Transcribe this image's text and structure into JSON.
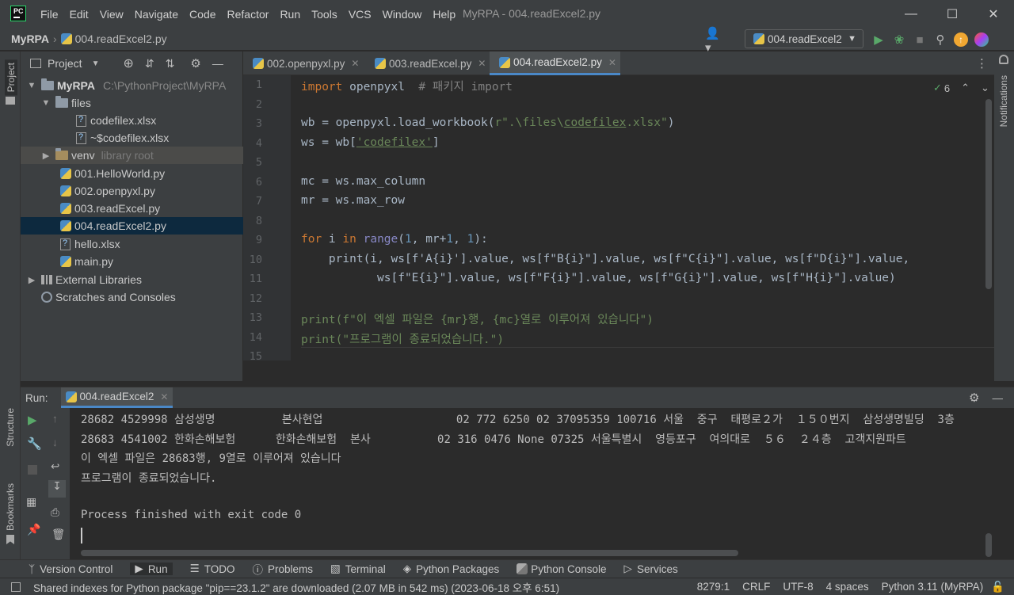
{
  "window": {
    "title": "MyRPA - 004.readExcel2.py",
    "menu": [
      "File",
      "Edit",
      "View",
      "Navigate",
      "Code",
      "Refactor",
      "Run",
      "Tools",
      "VCS",
      "Window",
      "Help"
    ]
  },
  "navbar": {
    "project": "MyRPA",
    "file": "004.readExcel2.py",
    "run_config": "004.readExcel2"
  },
  "project_panel": {
    "title": "Project",
    "root_name": "MyRPA",
    "root_path": "C:\\PythonProject\\MyRPA",
    "files_folder": "files",
    "file1": "codefilex.xlsx",
    "file2": "~$codefilex.xlsx",
    "venv": "venv",
    "venv_hint": "library root",
    "py1": "001.HelloWorld.py",
    "py2": "002.openpyxl.py",
    "py3": "003.readExcel.py",
    "py4": "004.readExcel2.py",
    "xlsx": "hello.xlsx",
    "main": "main.py",
    "ext_libs": "External Libraries",
    "scratches": "Scratches and Consoles"
  },
  "tabs": [
    "002.openpyxl.py",
    "003.readExcel.py",
    "004.readExcel2.py"
  ],
  "editor": {
    "line_numbers": [
      "1",
      "2",
      "3",
      "4",
      "5",
      "6",
      "7",
      "8",
      "9",
      "10",
      "11",
      "12",
      "13",
      "14",
      "15"
    ],
    "inspection_count": "6"
  },
  "code_lines": {
    "l1_kw": "import",
    "l1_mod": " openpyxl  ",
    "l1_cm": "# 패키지 import",
    "l3_a": "wb = openpyxl.load_workbook(",
    "l3_s1": "r\".\\files\\",
    "l3_s2": "codefilex",
    "l3_s3": ".xlsx\"",
    "l3_b": ")",
    "l4_a": "ws = wb[",
    "l4_s": "'codefilex'",
    "l4_b": "]",
    "l6": "mc = ws.max_column",
    "l7": "mr = ws.max_row",
    "l9_kw1": "for",
    "l9_a": " i ",
    "l9_kw2": "in",
    "l9_b": " ",
    "l9_bi": "range",
    "l9_c": "(",
    "l9_n1": "1",
    "l9_d": ", mr+",
    "l9_n2": "1",
    "l9_e": ", ",
    "l9_n3": "1",
    "l9_f": "):",
    "l10": "    print(i, ws[f'A{i}'].value, ws[f\"B{i}\"].value, ws[f\"C{i}\"].value, ws[f\"D{i}\"].value,",
    "l11": "           ws[f\"E{i}\"].value, ws[f\"F{i}\"].value, ws[f\"G{i}\"].value, ws[f\"H{i}\"].value)",
    "l13": "print(f\"이 엑셀 파일은 {mr}행, {mc}열로 이루어져 있습니다\")",
    "l14": "print(\"프로그램이 종료되었습니다.\")"
  },
  "run_panel": {
    "label": "Run:",
    "config": "004.readExcel2",
    "output": [
      "28682 4529998 삼성생명          본사현업                    02 772 6250 02 37095359 100716 서울  중구  태평로２가  １５０번지  삼성생명빌딩  3층",
      "28683 4541002 한화손해보험      한화손해보험  본사          02 316 0476 None 07325 서울특별시  영등포구  여의대로  ５６  ２４층  고객지원파트",
      "이 엑셀 파일은 28683행, 9열로 이루어져 있습니다",
      "프로그램이 종료되었습니다.",
      "",
      "Process finished with exit code 0"
    ]
  },
  "tool_windows": [
    "Version Control",
    "Run",
    "TODO",
    "Problems",
    "Terminal",
    "Python Packages",
    "Python Console",
    "Services"
  ],
  "side_labels": {
    "project": "Project",
    "structure": "Structure",
    "bookmarks": "Bookmarks",
    "notifications": "Notifications"
  },
  "status": {
    "message": "Shared indexes for Python package \"pip==23.1.2\" are downloaded (2.07 MB in 542 ms) (2023-06-18 오후 6:51)",
    "position": "8279:1",
    "line_sep": "CRLF",
    "encoding": "UTF-8",
    "indent": "4 spaces",
    "interpreter": "Python 3.11 (MyRPA)"
  }
}
